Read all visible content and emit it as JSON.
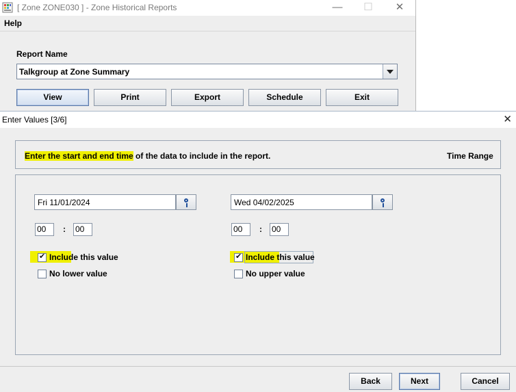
{
  "back_window": {
    "title": "[ Zone ZONE030 ] - Zone Historical Reports",
    "menu": {
      "help": "Help"
    },
    "report_name_label": "Report Name",
    "report_name_value": "Talkgroup at Zone Summary",
    "buttons": {
      "view": "View",
      "print": "Print",
      "export": "Export",
      "schedule": "Schedule",
      "exit": "Exit"
    },
    "controls": {
      "minimize": "—",
      "maximize": "☐",
      "close": "✕"
    }
  },
  "dialog": {
    "title": "Enter Values [3/6]",
    "close": "✕",
    "instruction_highlighted": "Enter the start and end time",
    "instruction_rest": " of the data to include in the report.",
    "section_label": "Time Range",
    "start": {
      "date": "Fri 11/01/2024",
      "hour": "00",
      "minute": "00",
      "colon": ":",
      "include_label_highlighted": "Includ",
      "include_label_rest": "e this value",
      "include_checked": true,
      "bound_label": "No lower value",
      "bound_checked": false
    },
    "end": {
      "date": "Wed 04/02/2025",
      "hour": "00",
      "minute": "00",
      "colon": ":",
      "include_label_highlighted": "Include th",
      "include_label_rest": "is value",
      "include_checked": true,
      "bound_label": "No upper value",
      "bound_checked": false
    },
    "buttons": {
      "back": "Back",
      "next": "Next",
      "cancel": "Cancel"
    }
  },
  "colors": {
    "highlight": "#f0f000",
    "panel_bg": "#eeeeee",
    "accent_border": "#5a78a8"
  }
}
